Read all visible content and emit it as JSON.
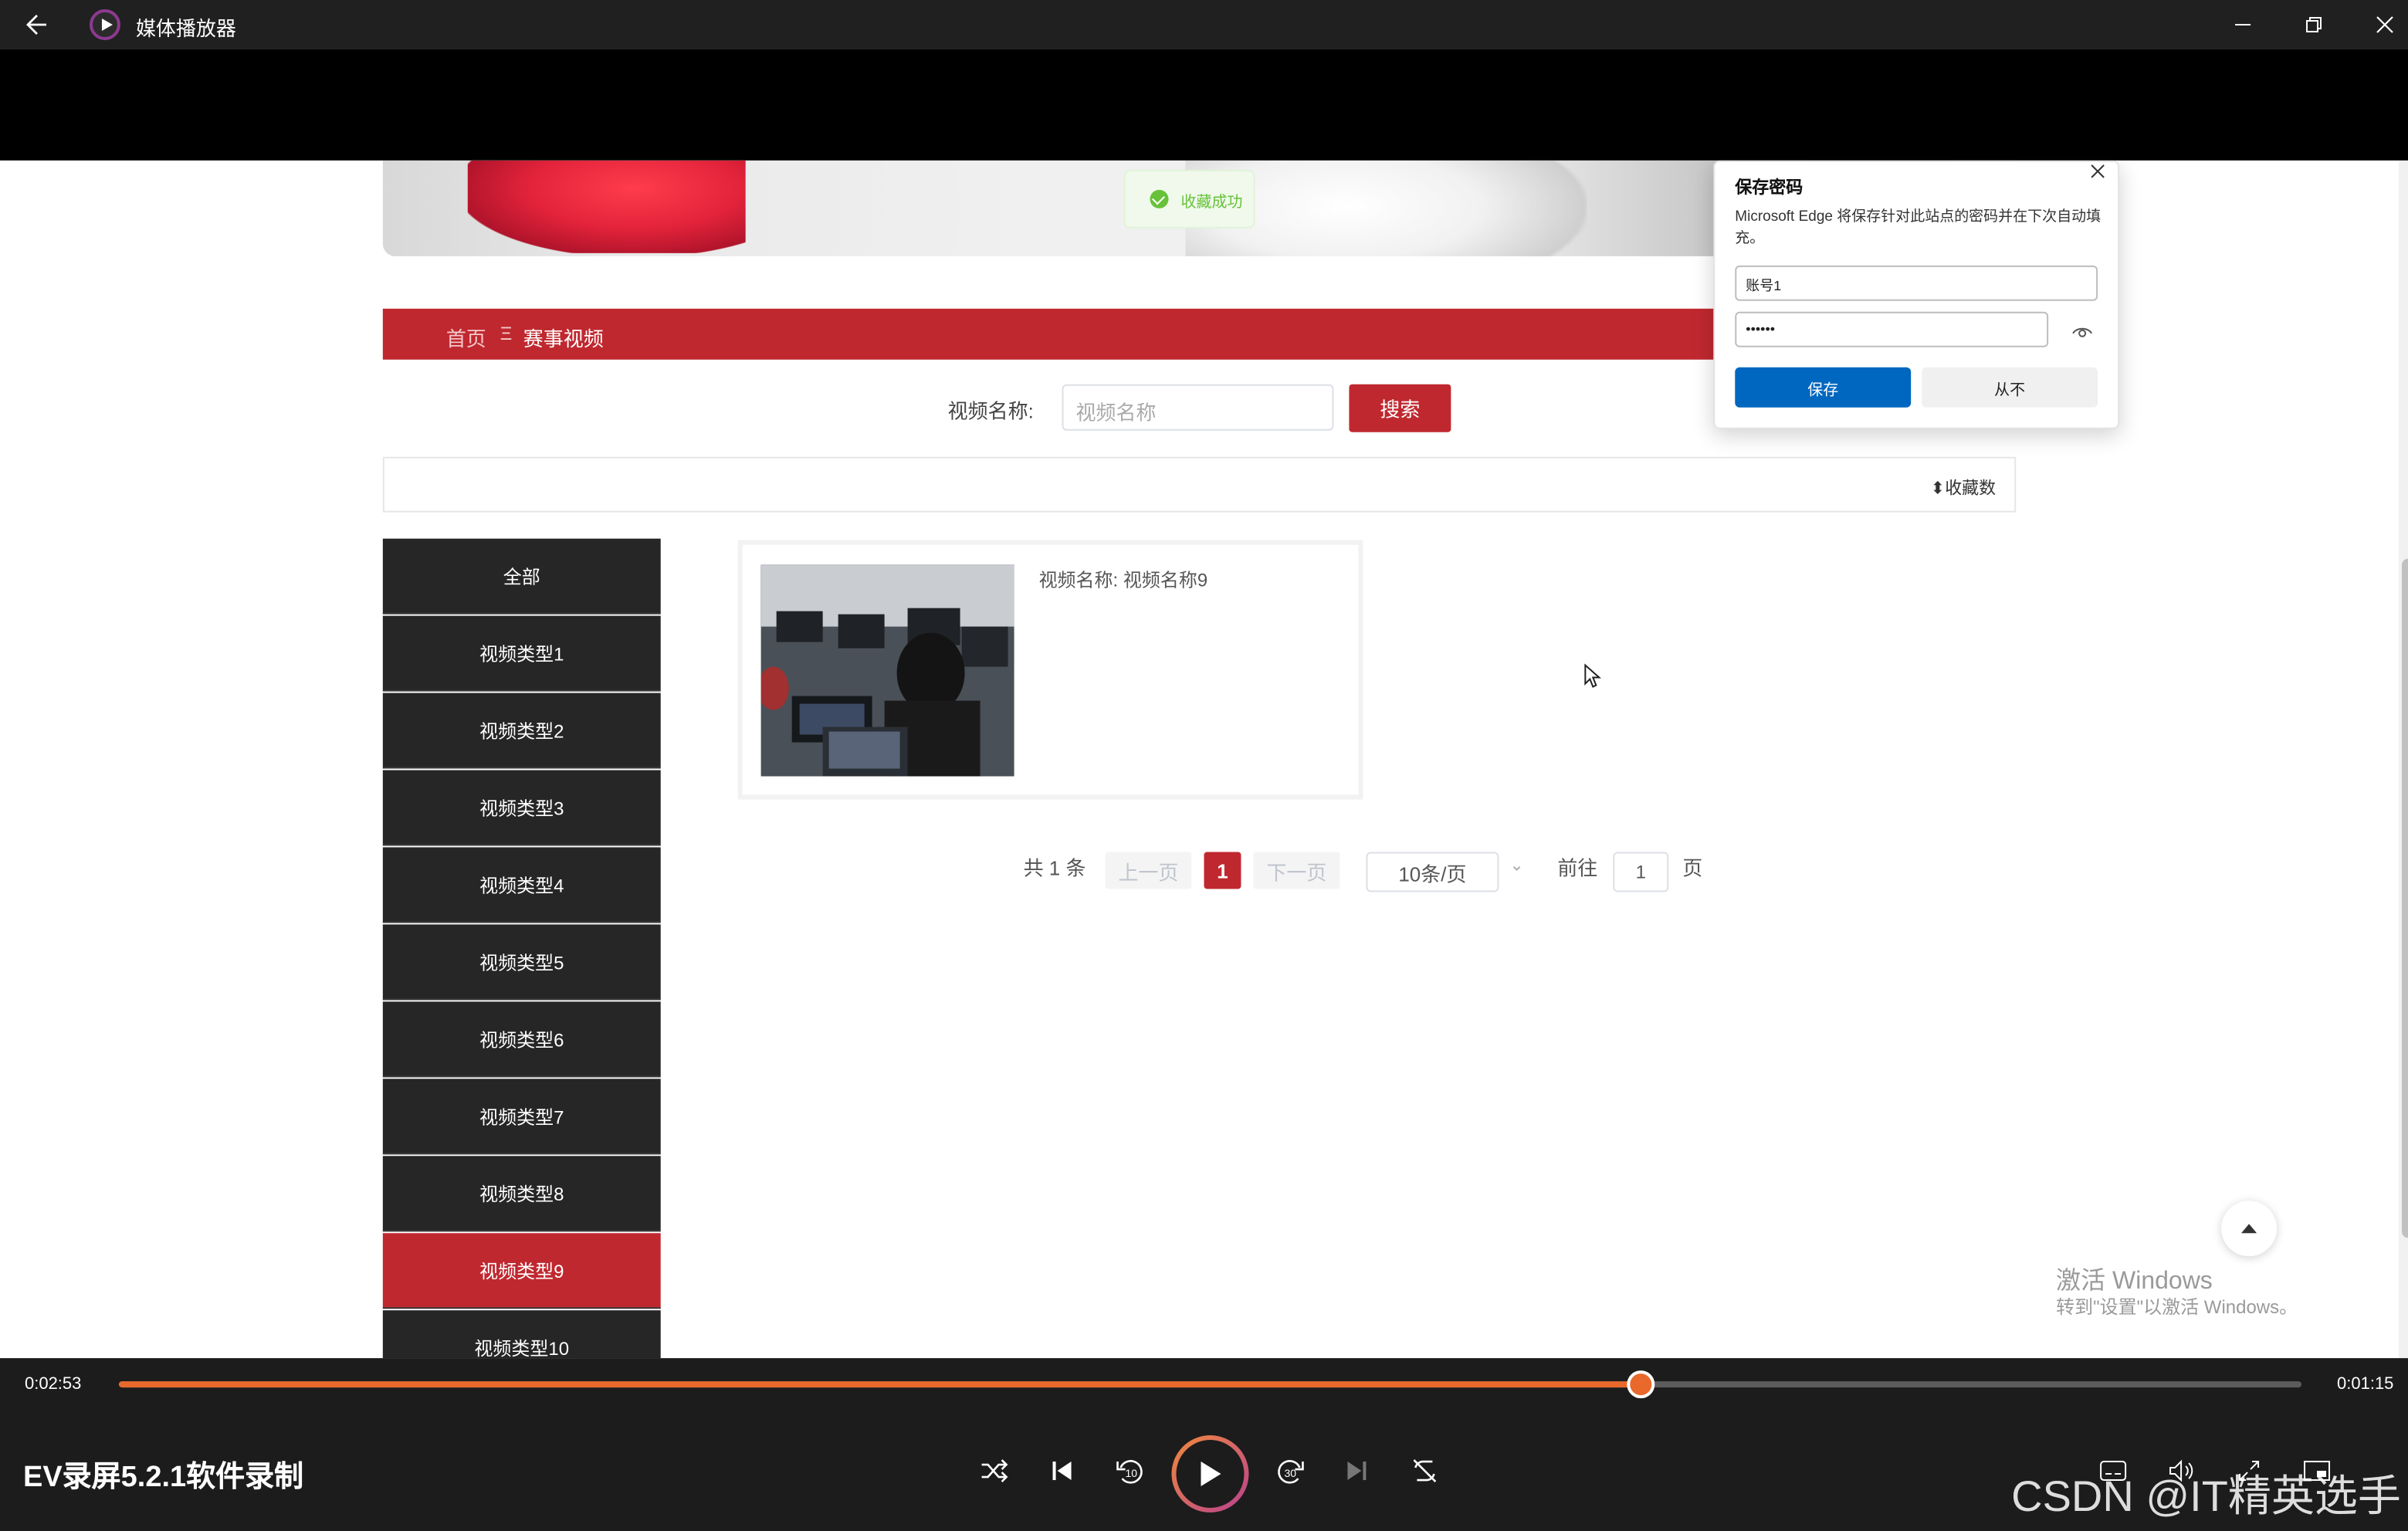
{
  "window": {
    "title": "媒体播放器"
  },
  "toast": {
    "text": "收藏成功"
  },
  "breadcrumb": {
    "home": "首页",
    "separator": "Ξ",
    "current": "赛事视频"
  },
  "search": {
    "label": "视频名称:",
    "placeholder": "视频名称",
    "button": "搜索"
  },
  "sort": {
    "label": "收藏数"
  },
  "sidebar": {
    "items": [
      {
        "label": "全部"
      },
      {
        "label": "视频类型1"
      },
      {
        "label": "视频类型2"
      },
      {
        "label": "视频类型3"
      },
      {
        "label": "视频类型4"
      },
      {
        "label": "视频类型5"
      },
      {
        "label": "视频类型6"
      },
      {
        "label": "视频类型7"
      },
      {
        "label": "视频类型8"
      },
      {
        "label": "视频类型9"
      },
      {
        "label": "视频类型10"
      }
    ],
    "active_index": 9
  },
  "results": [
    {
      "label": "视频名称: 视频名称9"
    }
  ],
  "pagination": {
    "total": "共 1 条",
    "prev": "上一页",
    "current": "1",
    "next": "下一页",
    "page_size": "10条/页",
    "goto_label": "前往",
    "goto_value": "1",
    "page_unit": "页"
  },
  "password_prompt": {
    "title": "保存密码",
    "description": "Microsoft Edge 将保存针对此站点的密码并在下次自动填充。",
    "username": "账号1",
    "password_mask": "••••••",
    "save": "保存",
    "never": "从不"
  },
  "watermark": {
    "line1": "激活 Windows",
    "line2": "转到\"设置\"以激活 Windows。"
  },
  "player": {
    "elapsed": "0:02:53",
    "remaining": "0:01:15",
    "progress": 0.697,
    "title": "EV录屏5.2.1软件录制",
    "accent": "#e8692b"
  },
  "overlay_watermark": "CSDN @IT精英选手",
  "colors": {
    "brand_red": "#c0282f",
    "sidebar_dark": "#262626",
    "edge_blue": "#0067c0"
  }
}
